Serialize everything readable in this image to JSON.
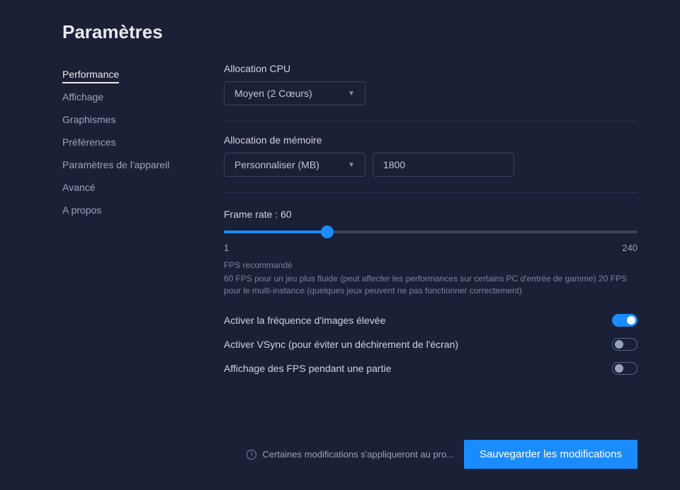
{
  "page_title": "Paramètres",
  "sidebar": {
    "items": [
      {
        "label": "Performance",
        "active": true
      },
      {
        "label": "Affichage",
        "active": false
      },
      {
        "label": "Graphismes",
        "active": false
      },
      {
        "label": "Préférences",
        "active": false
      },
      {
        "label": "Paramètres de l'appareil",
        "active": false
      },
      {
        "label": "Avancé",
        "active": false
      },
      {
        "label": "A propos",
        "active": false
      }
    ]
  },
  "cpu": {
    "label": "Allocation CPU",
    "selected": "Moyen (2 Cœurs)"
  },
  "memory": {
    "label": "Allocation de mémoire",
    "selected": "Personnaliser (MB)",
    "value": "1800"
  },
  "frame_rate": {
    "label_prefix": "Frame rate : ",
    "value": 60,
    "min": 1,
    "max": 240,
    "percent": 25
  },
  "fps_rec": {
    "title": "FPS recommandé",
    "body": "60 FPS pour un jeu plus fluide (peut affecter les performances sur certains PC d'entrée de gamme) 20 FPS pour le multi-instance (quelques jeux peuvent ne pas fonctionner correctement)"
  },
  "toggles": [
    {
      "label": "Activer la fréquence d'images élevée",
      "on": true
    },
    {
      "label": "Activer VSync (pour éviter un déchirement de l'écran)",
      "on": false
    },
    {
      "label": "Affichage des FPS pendant une partie",
      "on": false
    }
  ],
  "footer": {
    "note": "Certaines modifications s'appliqueront au pro...",
    "save_label": "Sauvegarder les modifications"
  }
}
